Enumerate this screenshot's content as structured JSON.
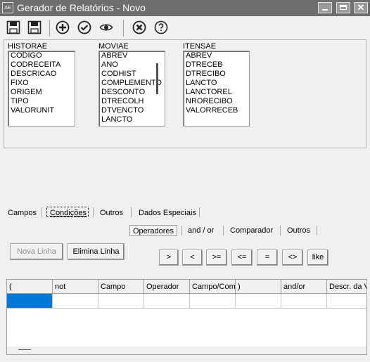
{
  "window": {
    "icon_text": "AE",
    "title": "Gerador de Relatórios - Novo",
    "close_symbol": "✕"
  },
  "tables": [
    {
      "name": "HISTORAE",
      "fields": [
        "CODIGO",
        "CODRECEITA",
        "DESCRICAO",
        "FIXO",
        "ORIGEM",
        "TIPO",
        "VALORUNIT"
      ]
    },
    {
      "name": "MOVIAE",
      "fields": [
        "ABREV",
        "ANO",
        "CODHIST",
        "COMPLEMENTO",
        "DESCONTO",
        "DTRECOLH",
        "DTVENCTO",
        "LANCTO"
      ]
    },
    {
      "name": "ITENSAE",
      "fields": [
        "ABREV",
        "DTRECEB",
        "DTRECIBO",
        "LANCTO",
        "LANCTOREL",
        "NRORECIBO",
        "VALORRECEB"
      ]
    }
  ],
  "tabs": [
    "Campos",
    "Condições",
    "Outros",
    "Dados Especiais"
  ],
  "subtabs": [
    "Operadores",
    "and / or",
    "Comparador",
    "Outros"
  ],
  "buttons": {
    "nova_linha": "Nova Linha",
    "elimina_linha": "Elimina Linha"
  },
  "operators": [
    ">",
    "<",
    ">=",
    "<=",
    "=",
    "<>",
    "like"
  ],
  "grid": {
    "columns": [
      "(",
      "not",
      "Campo",
      "Operador",
      "Campo/Comp",
      ")",
      "and/or",
      "Descr. da V"
    ]
  },
  "colors": {
    "titlebar": "#6e6e6e",
    "selected_cell": "#0078d7"
  }
}
